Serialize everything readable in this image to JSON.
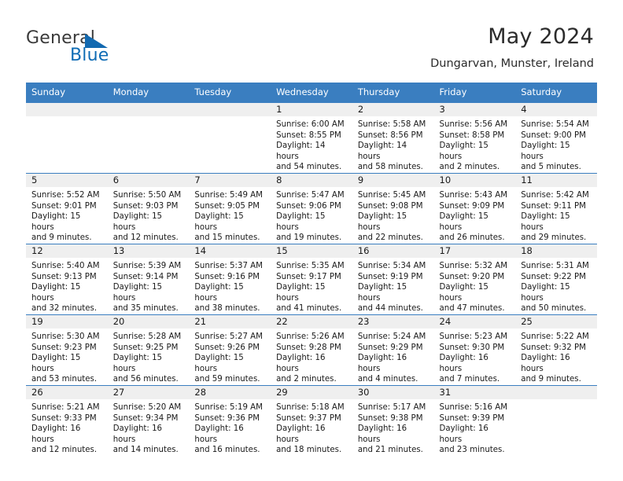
{
  "brand": {
    "name_part1": "General",
    "name_part2": "Blue",
    "accent_color": "#1269b0",
    "triangle_icon": "triangle-icon"
  },
  "header": {
    "title": "May 2024",
    "location": "Dungarvan, Munster, Ireland"
  },
  "calendar": {
    "header_bg": "#3a7ec0",
    "daynum_bg": "#efefef",
    "weekdays": [
      "Sunday",
      "Monday",
      "Tuesday",
      "Wednesday",
      "Thursday",
      "Friday",
      "Saturday"
    ],
    "weeks": [
      [
        {
          "day": "",
          "sunrise": "",
          "sunset": "",
          "daylight1": "",
          "daylight2": ""
        },
        {
          "day": "",
          "sunrise": "",
          "sunset": "",
          "daylight1": "",
          "daylight2": ""
        },
        {
          "day": "",
          "sunrise": "",
          "sunset": "",
          "daylight1": "",
          "daylight2": ""
        },
        {
          "day": "1",
          "sunrise": "Sunrise: 6:00 AM",
          "sunset": "Sunset: 8:55 PM",
          "daylight1": "Daylight: 14 hours",
          "daylight2": "and 54 minutes."
        },
        {
          "day": "2",
          "sunrise": "Sunrise: 5:58 AM",
          "sunset": "Sunset: 8:56 PM",
          "daylight1": "Daylight: 14 hours",
          "daylight2": "and 58 minutes."
        },
        {
          "day": "3",
          "sunrise": "Sunrise: 5:56 AM",
          "sunset": "Sunset: 8:58 PM",
          "daylight1": "Daylight: 15 hours",
          "daylight2": "and 2 minutes."
        },
        {
          "day": "4",
          "sunrise": "Sunrise: 5:54 AM",
          "sunset": "Sunset: 9:00 PM",
          "daylight1": "Daylight: 15 hours",
          "daylight2": "and 5 minutes."
        }
      ],
      [
        {
          "day": "5",
          "sunrise": "Sunrise: 5:52 AM",
          "sunset": "Sunset: 9:01 PM",
          "daylight1": "Daylight: 15 hours",
          "daylight2": "and 9 minutes."
        },
        {
          "day": "6",
          "sunrise": "Sunrise: 5:50 AM",
          "sunset": "Sunset: 9:03 PM",
          "daylight1": "Daylight: 15 hours",
          "daylight2": "and 12 minutes."
        },
        {
          "day": "7",
          "sunrise": "Sunrise: 5:49 AM",
          "sunset": "Sunset: 9:05 PM",
          "daylight1": "Daylight: 15 hours",
          "daylight2": "and 15 minutes."
        },
        {
          "day": "8",
          "sunrise": "Sunrise: 5:47 AM",
          "sunset": "Sunset: 9:06 PM",
          "daylight1": "Daylight: 15 hours",
          "daylight2": "and 19 minutes."
        },
        {
          "day": "9",
          "sunrise": "Sunrise: 5:45 AM",
          "sunset": "Sunset: 9:08 PM",
          "daylight1": "Daylight: 15 hours",
          "daylight2": "and 22 minutes."
        },
        {
          "day": "10",
          "sunrise": "Sunrise: 5:43 AM",
          "sunset": "Sunset: 9:09 PM",
          "daylight1": "Daylight: 15 hours",
          "daylight2": "and 26 minutes."
        },
        {
          "day": "11",
          "sunrise": "Sunrise: 5:42 AM",
          "sunset": "Sunset: 9:11 PM",
          "daylight1": "Daylight: 15 hours",
          "daylight2": "and 29 minutes."
        }
      ],
      [
        {
          "day": "12",
          "sunrise": "Sunrise: 5:40 AM",
          "sunset": "Sunset: 9:13 PM",
          "daylight1": "Daylight: 15 hours",
          "daylight2": "and 32 minutes."
        },
        {
          "day": "13",
          "sunrise": "Sunrise: 5:39 AM",
          "sunset": "Sunset: 9:14 PM",
          "daylight1": "Daylight: 15 hours",
          "daylight2": "and 35 minutes."
        },
        {
          "day": "14",
          "sunrise": "Sunrise: 5:37 AM",
          "sunset": "Sunset: 9:16 PM",
          "daylight1": "Daylight: 15 hours",
          "daylight2": "and 38 minutes."
        },
        {
          "day": "15",
          "sunrise": "Sunrise: 5:35 AM",
          "sunset": "Sunset: 9:17 PM",
          "daylight1": "Daylight: 15 hours",
          "daylight2": "and 41 minutes."
        },
        {
          "day": "16",
          "sunrise": "Sunrise: 5:34 AM",
          "sunset": "Sunset: 9:19 PM",
          "daylight1": "Daylight: 15 hours",
          "daylight2": "and 44 minutes."
        },
        {
          "day": "17",
          "sunrise": "Sunrise: 5:32 AM",
          "sunset": "Sunset: 9:20 PM",
          "daylight1": "Daylight: 15 hours",
          "daylight2": "and 47 minutes."
        },
        {
          "day": "18",
          "sunrise": "Sunrise: 5:31 AM",
          "sunset": "Sunset: 9:22 PM",
          "daylight1": "Daylight: 15 hours",
          "daylight2": "and 50 minutes."
        }
      ],
      [
        {
          "day": "19",
          "sunrise": "Sunrise: 5:30 AM",
          "sunset": "Sunset: 9:23 PM",
          "daylight1": "Daylight: 15 hours",
          "daylight2": "and 53 minutes."
        },
        {
          "day": "20",
          "sunrise": "Sunrise: 5:28 AM",
          "sunset": "Sunset: 9:25 PM",
          "daylight1": "Daylight: 15 hours",
          "daylight2": "and 56 minutes."
        },
        {
          "day": "21",
          "sunrise": "Sunrise: 5:27 AM",
          "sunset": "Sunset: 9:26 PM",
          "daylight1": "Daylight: 15 hours",
          "daylight2": "and 59 minutes."
        },
        {
          "day": "22",
          "sunrise": "Sunrise: 5:26 AM",
          "sunset": "Sunset: 9:28 PM",
          "daylight1": "Daylight: 16 hours",
          "daylight2": "and 2 minutes."
        },
        {
          "day": "23",
          "sunrise": "Sunrise: 5:24 AM",
          "sunset": "Sunset: 9:29 PM",
          "daylight1": "Daylight: 16 hours",
          "daylight2": "and 4 minutes."
        },
        {
          "day": "24",
          "sunrise": "Sunrise: 5:23 AM",
          "sunset": "Sunset: 9:30 PM",
          "daylight1": "Daylight: 16 hours",
          "daylight2": "and 7 minutes."
        },
        {
          "day": "25",
          "sunrise": "Sunrise: 5:22 AM",
          "sunset": "Sunset: 9:32 PM",
          "daylight1": "Daylight: 16 hours",
          "daylight2": "and 9 minutes."
        }
      ],
      [
        {
          "day": "26",
          "sunrise": "Sunrise: 5:21 AM",
          "sunset": "Sunset: 9:33 PM",
          "daylight1": "Daylight: 16 hours",
          "daylight2": "and 12 minutes."
        },
        {
          "day": "27",
          "sunrise": "Sunrise: 5:20 AM",
          "sunset": "Sunset: 9:34 PM",
          "daylight1": "Daylight: 16 hours",
          "daylight2": "and 14 minutes."
        },
        {
          "day": "28",
          "sunrise": "Sunrise: 5:19 AM",
          "sunset": "Sunset: 9:36 PM",
          "daylight1": "Daylight: 16 hours",
          "daylight2": "and 16 minutes."
        },
        {
          "day": "29",
          "sunrise": "Sunrise: 5:18 AM",
          "sunset": "Sunset: 9:37 PM",
          "daylight1": "Daylight: 16 hours",
          "daylight2": "and 18 minutes."
        },
        {
          "day": "30",
          "sunrise": "Sunrise: 5:17 AM",
          "sunset": "Sunset: 9:38 PM",
          "daylight1": "Daylight: 16 hours",
          "daylight2": "and 21 minutes."
        },
        {
          "day": "31",
          "sunrise": "Sunrise: 5:16 AM",
          "sunset": "Sunset: 9:39 PM",
          "daylight1": "Daylight: 16 hours",
          "daylight2": "and 23 minutes."
        },
        {
          "day": "",
          "sunrise": "",
          "sunset": "",
          "daylight1": "",
          "daylight2": ""
        }
      ]
    ]
  }
}
